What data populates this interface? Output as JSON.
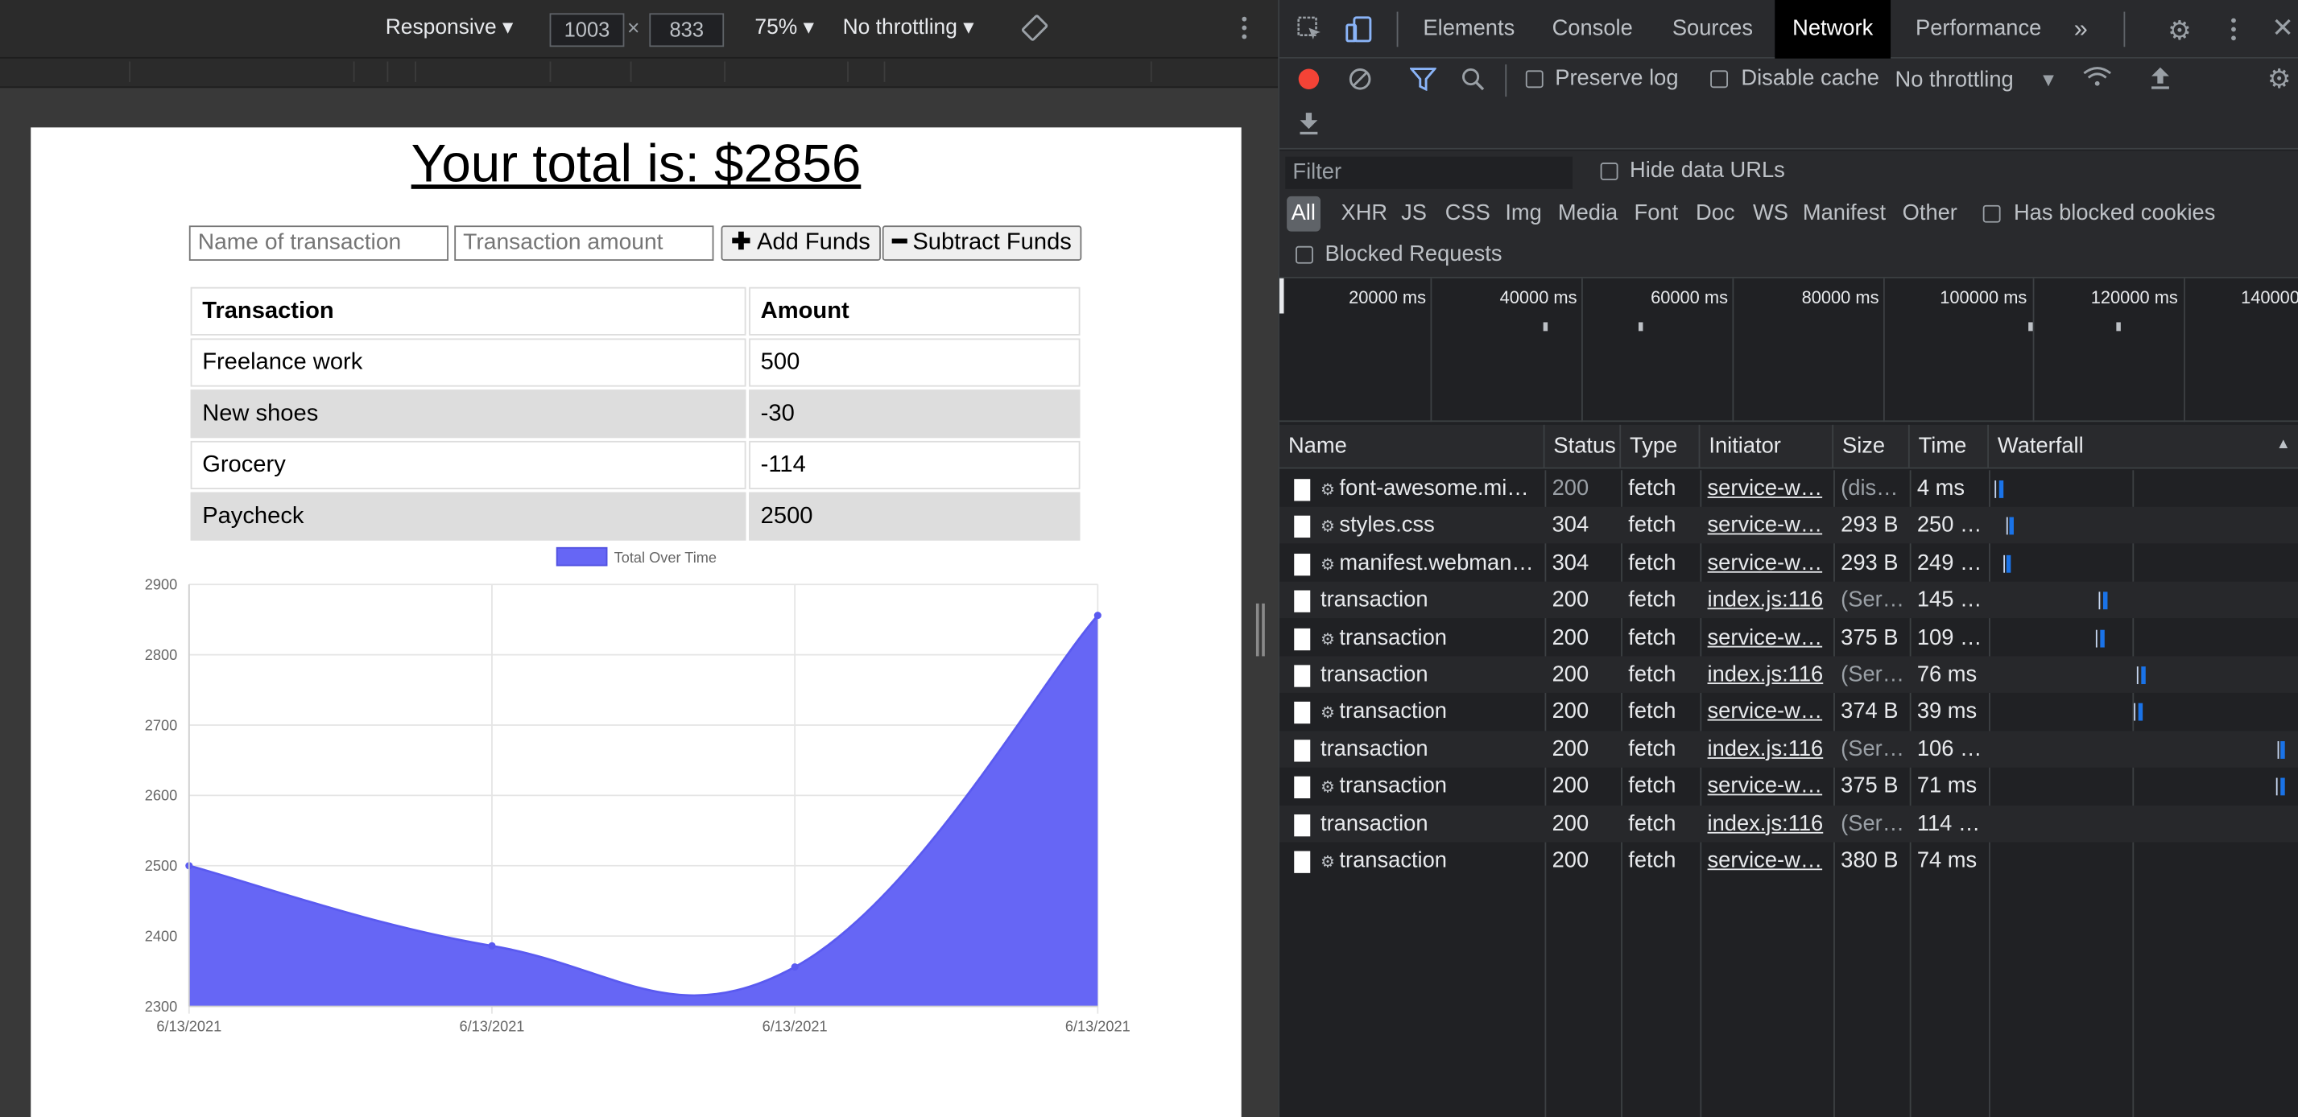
{
  "device_toolbar": {
    "mode": "Responsive",
    "width": "1003",
    "height": "833",
    "zoom": "75%",
    "throttling": "No throttling"
  },
  "page": {
    "total_title": "Your total is: $2856",
    "name_placeholder": "Name of transaction",
    "amount_placeholder": "Transaction amount",
    "add_label": "Add Funds",
    "subtract_label": "Subtract Funds",
    "table": {
      "headers": [
        "Transaction",
        "Amount"
      ],
      "rows": [
        {
          "name": "Freelance work",
          "amount": "500"
        },
        {
          "name": "New shoes",
          "amount": "-30"
        },
        {
          "name": "Grocery",
          "amount": "-114"
        },
        {
          "name": "Paycheck",
          "amount": "2500"
        }
      ]
    }
  },
  "chart_data": {
    "type": "area",
    "title": "",
    "legend": "Total Over Time",
    "legend_placement": "top",
    "fill_color": "#6666f5",
    "categories": [
      "6/13/2021",
      "6/13/2021",
      "6/13/2021",
      "6/13/2021"
    ],
    "series": [
      {
        "name": "Total Over Time",
        "values": [
          2500,
          2386,
          2356,
          2856
        ]
      }
    ],
    "yticks": [
      2300,
      2400,
      2500,
      2600,
      2700,
      2800,
      2900
    ],
    "ylim": [
      2300,
      2900
    ],
    "grid": true,
    "xlabel": "",
    "ylabel": ""
  },
  "devtools": {
    "tabs": [
      "Elements",
      "Console",
      "Sources",
      "Network",
      "Performance"
    ],
    "active_tab": "Network",
    "preserve_log": "Preserve log",
    "disable_cache": "Disable cache",
    "throttling": "No throttling",
    "filter_placeholder": "Filter",
    "hide_data_urls": "Hide data URLs",
    "types": [
      "All",
      "XHR",
      "JS",
      "CSS",
      "Img",
      "Media",
      "Font",
      "Doc",
      "WS",
      "Manifest",
      "Other"
    ],
    "has_blocked_cookies": "Has blocked cookies",
    "blocked_requests": "Blocked Requests",
    "overview_ticks": [
      "20000 ms",
      "40000 ms",
      "60000 ms",
      "80000 ms",
      "100000 ms",
      "120000 ms",
      "140000"
    ],
    "columns": [
      "Name",
      "Status",
      "Type",
      "Initiator",
      "Size",
      "Time",
      "Waterfall"
    ],
    "requests": [
      {
        "gear": true,
        "name": "font-awesome.mi…",
        "status": "200",
        "status_dim": true,
        "type": "fetch",
        "initiator": "service-w…",
        "size": "(dis…",
        "size_dim": true,
        "time": "4 ms"
      },
      {
        "gear": true,
        "name": "styles.css",
        "status": "304",
        "status_dim": false,
        "type": "fetch",
        "initiator": "service-w…",
        "size": "293 B",
        "size_dim": false,
        "time": "250 …"
      },
      {
        "gear": true,
        "name": "manifest.webman…",
        "status": "304",
        "status_dim": false,
        "type": "fetch",
        "initiator": "service-w…",
        "size": "293 B",
        "size_dim": false,
        "time": "249 …"
      },
      {
        "gear": false,
        "name": "transaction",
        "status": "200",
        "status_dim": false,
        "type": "fetch",
        "initiator": "index.js:116",
        "size": "(Ser…",
        "size_dim": true,
        "time": "145 …"
      },
      {
        "gear": true,
        "name": "transaction",
        "status": "200",
        "status_dim": false,
        "type": "fetch",
        "initiator": "service-w…",
        "size": "375 B",
        "size_dim": false,
        "time": "109 …"
      },
      {
        "gear": false,
        "name": "transaction",
        "status": "200",
        "status_dim": false,
        "type": "fetch",
        "initiator": "index.js:116",
        "size": "(Ser…",
        "size_dim": true,
        "time": "76 ms"
      },
      {
        "gear": true,
        "name": "transaction",
        "status": "200",
        "status_dim": false,
        "type": "fetch",
        "initiator": "service-w…",
        "size": "374 B",
        "size_dim": false,
        "time": "39 ms"
      },
      {
        "gear": false,
        "name": "transaction",
        "status": "200",
        "status_dim": false,
        "type": "fetch",
        "initiator": "index.js:116",
        "size": "(Ser…",
        "size_dim": true,
        "time": "106 …"
      },
      {
        "gear": true,
        "name": "transaction",
        "status": "200",
        "status_dim": false,
        "type": "fetch",
        "initiator": "service-w…",
        "size": "375 B",
        "size_dim": false,
        "time": "71 ms"
      },
      {
        "gear": false,
        "name": "transaction",
        "status": "200",
        "status_dim": false,
        "type": "fetch",
        "initiator": "index.js:116",
        "size": "(Ser…",
        "size_dim": true,
        "time": "114 …"
      },
      {
        "gear": true,
        "name": "transaction",
        "status": "200",
        "status_dim": false,
        "type": "fetch",
        "initiator": "service-w…",
        "size": "380 B",
        "size_dim": false,
        "time": "74 ms"
      }
    ]
  }
}
